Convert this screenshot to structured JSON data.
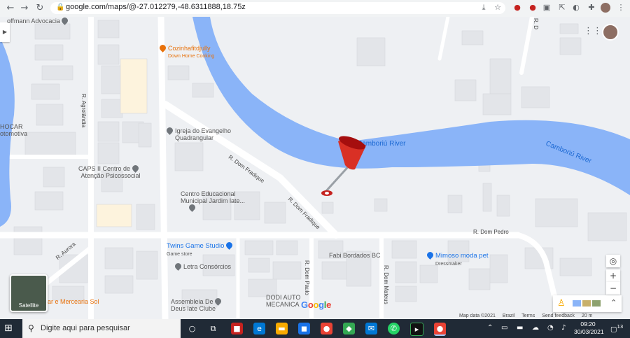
{
  "browser": {
    "url": "google.com/maps/@-27.012279,-48.6311888,18.75z",
    "nav": [
      "back-arrow",
      "forward-arrow",
      "reload"
    ],
    "extensions": [
      "download-icon",
      "star-icon",
      "adblock-icon",
      "extension-2-icon",
      "photo-icon",
      "external-icon",
      "puzzle-icon",
      "profile-icon",
      "menu-icon"
    ]
  },
  "map": {
    "rivers": [
      {
        "label": "Camboriú River"
      },
      {
        "label": "Camboriú River"
      }
    ],
    "pois": [
      {
        "name": "Cozinhafitdjully",
        "sub": "Down Home Cooking",
        "color": "#e8710a"
      },
      {
        "name": "Igreja do Evangelho",
        "sub": "Quadrangular",
        "color": "#70757a"
      },
      {
        "name": "CAPS II Centro de",
        "sub": "Atenção Psicossocial",
        "color": "#70757a"
      },
      {
        "name": "Centro Educacional",
        "sub": "Municipal Jardim late...",
        "color": "#70757a"
      },
      {
        "name": "Twins Game Studio",
        "sub": "Game store",
        "color": "#1a73e8"
      },
      {
        "name": "Letra Consórcios",
        "sub": "",
        "color": "#70757a"
      },
      {
        "name": "Fabi Bordados BC",
        "sub": "",
        "color": "#70757a"
      },
      {
        "name": "Mimoso moda pet",
        "sub": "Dressmaker",
        "color": "#1a73e8"
      },
      {
        "name": "Assembleia De",
        "sub": "Deus late Clube",
        "color": "#70757a"
      },
      {
        "name": "DODI AUTO",
        "sub": "MECANICA",
        "color": "#70757a"
      },
      {
        "name": "lar e Mercearia Sol",
        "sub": "",
        "color": "#e8710a"
      },
      {
        "name": "offmann Advocacia",
        "sub": "",
        "color": "#70757a"
      },
      {
        "name": "HOCAR",
        "sub": "otomotiva",
        "color": "#70757a"
      }
    ],
    "streets": [
      "R. Agrolândia",
      "R. Dom Fradique",
      "R. Dom Fradique",
      "R. Dom Pedro",
      "R. Aurora",
      "R. Dom Paulo",
      "R. Dom Mateus",
      "R. D"
    ],
    "satellite_label": "Satellite",
    "google_logo": "Google",
    "footer": [
      "Map data ©2021",
      "Brazil",
      "Terms",
      "Send feedback",
      "20 m"
    ],
    "controls": [
      "locate-icon",
      "zoom-in",
      "zoom-out"
    ],
    "zoom_in": "+",
    "zoom_out": "−",
    "colors": {
      "water": "#8ab4f8",
      "road": "#ffffff",
      "building": "#e2e4e8",
      "marker": "#c5221f"
    }
  },
  "taskbar": {
    "search_placeholder": "Digite aqui para pesquisar",
    "time": "09:20",
    "date": "30/03/2021",
    "notifications": "13"
  }
}
